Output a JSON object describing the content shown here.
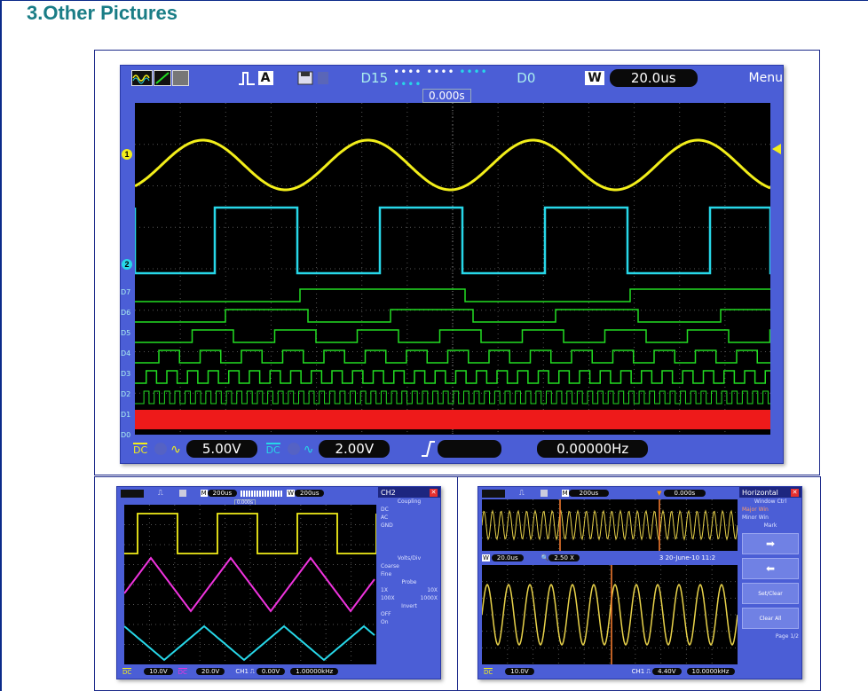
{
  "page": {
    "heading": "3.Other Pictures"
  },
  "main_scope": {
    "digital_range": {
      "high": "D15",
      "low": "D0"
    },
    "horizontal": {
      "window_label": "W",
      "timebase": "20.0us"
    },
    "menu_label": "Menu",
    "trigger_position": "0.000s",
    "channel_markers": {
      "ch1": "1",
      "ch2": "2"
    },
    "digital_labels": [
      "D7",
      "D6",
      "D5",
      "D4",
      "D3",
      "D2",
      "D1",
      "D0"
    ],
    "ch1": {
      "coupling": "DC",
      "volts_per_div": "5.00V"
    },
    "ch2": {
      "coupling": "DC",
      "volts_per_div": "2.00V"
    },
    "frequency": "0.00000Hz",
    "colors": {
      "ch1": "#f2ee1a",
      "ch2": "#27d7e8",
      "digital": "#22dd22",
      "d0": "#ee1a1a",
      "screen": "#000000",
      "frame": "#4b5ed6"
    }
  },
  "left_scope": {
    "timebase_a": "200us",
    "window_label": "W",
    "timebase_b": "200us",
    "trigger_position": "0.000s",
    "panel": {
      "title": "CH2",
      "close": "✕",
      "coupling_title": "Coupling",
      "coupling_options": [
        "DC",
        "AC",
        "GND"
      ],
      "volts_title": "Volts/Div",
      "volts_options": [
        "Coarse",
        "Fine"
      ],
      "probe_title": "Probe",
      "probe_options": [
        "1X",
        "10X",
        "100X",
        "1000X"
      ],
      "invert_title": "Invert",
      "invert_options": [
        "OFF",
        "On"
      ]
    },
    "bottom": {
      "ch1_volts": "10.0V",
      "ch2_volts": "20.0V",
      "trigger_label": "CH1",
      "trigger_level": "0.00V",
      "frequency": "1.00000kHz"
    }
  },
  "right_scope": {
    "timebase": "200us",
    "trigger_time": "0.000s",
    "window_label": "W",
    "window_timebase": "20.0us",
    "zoom": "2.50 X",
    "date": "3 20-June-10 11:2",
    "panel": {
      "title": "Horizontal",
      "close": "✕",
      "window_ctrl_title": "Window Ctrl",
      "window_options": [
        "Major Win",
        "Minor Win"
      ],
      "mark_title": "Mark",
      "set_clear": "Set/Clear",
      "clear_all": "Clear All",
      "page": "Page 1/2"
    },
    "bottom": {
      "ch1_volts": "10.0V",
      "trigger_label": "CH1",
      "trigger_level": "4.40V",
      "frequency": "10.0000kHz"
    }
  }
}
